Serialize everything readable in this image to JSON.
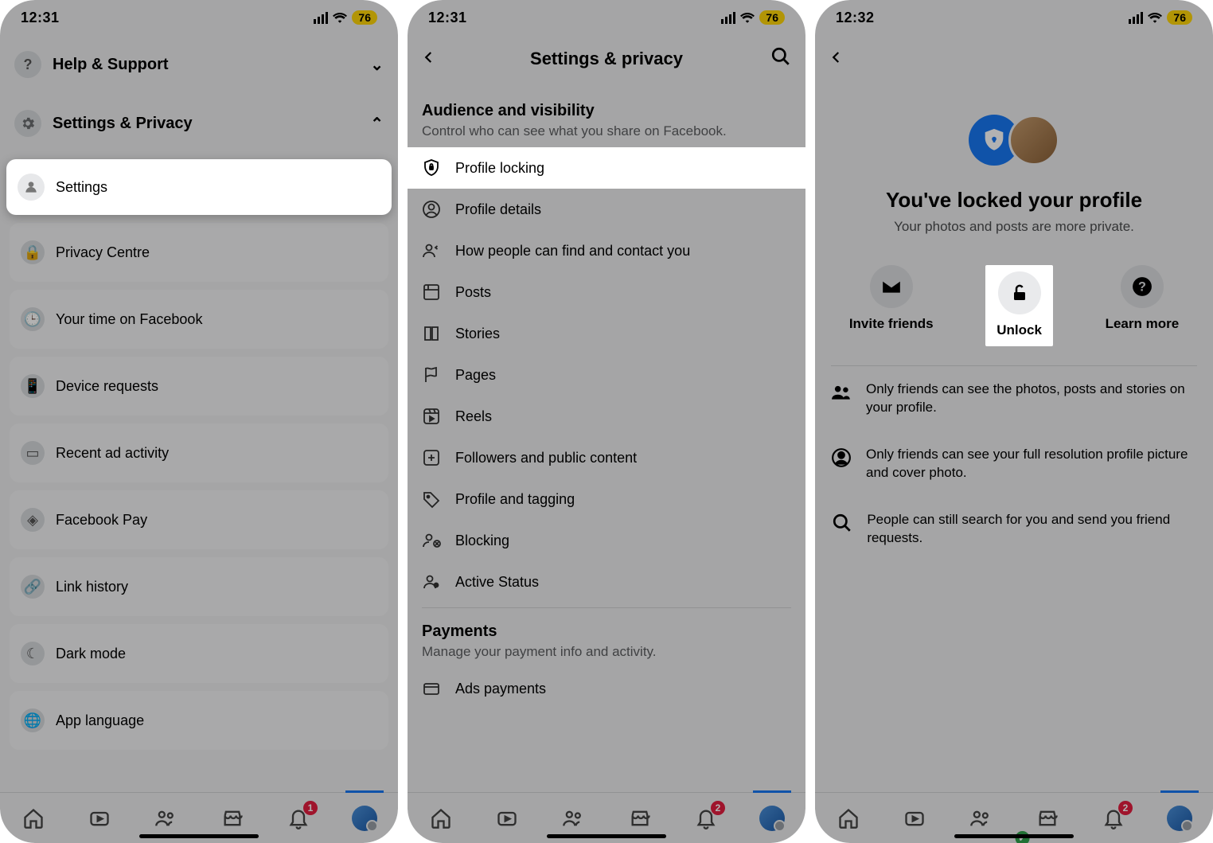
{
  "status": {
    "time1": "12:31",
    "time2": "12:31",
    "time3": "12:32",
    "battery": "76"
  },
  "panel1": {
    "help": "Help & Support",
    "settingsPrivacy": "Settings & Privacy",
    "settings": "Settings",
    "items": [
      "Privacy Centre",
      "Your time on Facebook",
      "Device requests",
      "Recent ad activity",
      "Facebook Pay",
      "Link history",
      "Dark mode",
      "App language"
    ]
  },
  "panel2": {
    "title": "Settings & privacy",
    "sectionTitle": "Audience and visibility",
    "sectionSub": "Control who can see what you share on Facebook.",
    "rows": [
      "Profile locking",
      "Profile details",
      "How people can find and contact you",
      "Posts",
      "Stories",
      "Pages",
      "Reels",
      "Followers and public content",
      "Profile and tagging",
      "Blocking",
      "Active Status"
    ],
    "paymentsTitle": "Payments",
    "paymentsSub": "Manage your payment info and activity.",
    "paymentsRow": "Ads payments"
  },
  "panel3": {
    "title": "You've locked your profile",
    "sub": "Your photos and posts are more private.",
    "action1": "Invite friends",
    "action2": "Unlock",
    "action3": "Learn more",
    "info1": "Only friends can see the photos, posts and stories on your profile.",
    "info2": "Only friends can see your full resolution profile picture and cover photo.",
    "info3": "People can still search for you and send you friend requests."
  },
  "tabbar": {
    "badge1": "1",
    "badge2": "2",
    "badge3": "2"
  }
}
